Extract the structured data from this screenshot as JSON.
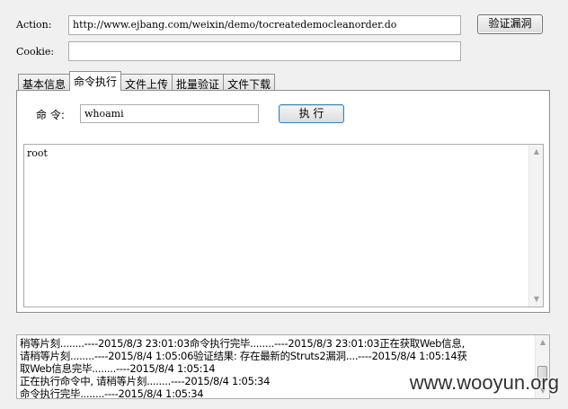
{
  "form": {
    "action_label": "Action:",
    "action_value": "http://www.ejbang.com/weixin/demo/tocreatedemocleanorder.do",
    "verify_button": "验证漏洞",
    "cookie_label": "Cookie:",
    "cookie_value": ""
  },
  "tabs": [
    {
      "label": "基本信息",
      "active": false
    },
    {
      "label": "命令执行",
      "active": true
    },
    {
      "label": "文件上传",
      "active": false
    },
    {
      "label": "批量验证",
      "active": false
    },
    {
      "label": "文件下载",
      "active": false
    }
  ],
  "command": {
    "label": "命 令:",
    "value": "whoami",
    "run_button": "执 行",
    "output": "root"
  },
  "log": {
    "lines": [
      "稍等片刻........----2015/8/3 23:01:03命令执行完毕........----2015/8/3 23:01:03正在获取Web信息,",
      "请稍等片刻........----2015/8/4 1:05:06验证结果: 存在最新的Struts2漏洞....----2015/8/4 1:05:14获",
      "取Web信息完毕........----2015/8/4 1:05:14",
      "正在执行命令中, 请稍等片刻........----2015/8/4 1:05:34",
      "命令执行完毕........----2015/8/4 1:05:34"
    ]
  },
  "watermark": "www.wooyun.org"
}
